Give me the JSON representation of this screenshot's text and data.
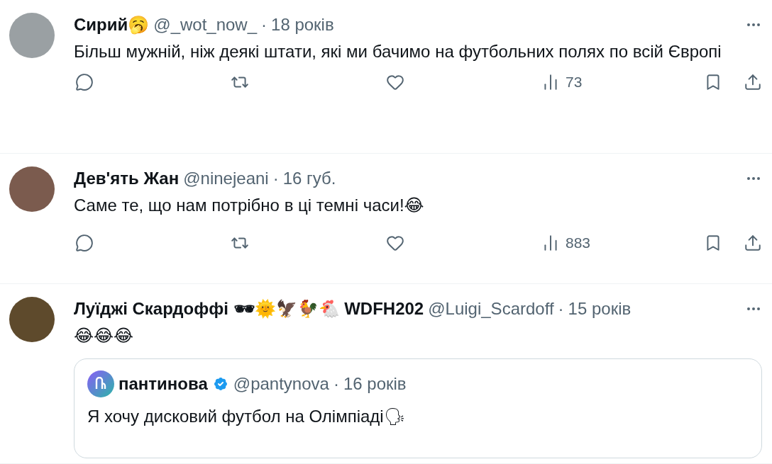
{
  "tweets": [
    {
      "name": "Сирий🥱",
      "handle": "@_wot_now_",
      "dot": "·",
      "time": "18 років",
      "text": "Більш мужній, ніж деякі штати, які ми бачимо на футбольних полях по всій Європі",
      "views": "73"
    },
    {
      "name": "Дев'ять Жан",
      "handle": "@ninejeani",
      "dot": "·",
      "time": "16 губ.",
      "text": "Саме те, що нам потрібно в ці темні часи!😂",
      "views": "883"
    },
    {
      "name": "Луїджі Скардоффі 🕶🌞🦅🐓🐔 WDFH202",
      "handle": "@Luigi_Scardoff",
      "dot": "·",
      "time": "15 років",
      "text": "😂😂😂",
      "quote": {
        "name": "пантинова",
        "verified": true,
        "handle": "@pantynova",
        "dot": "·",
        "time": "16 років",
        "text": "Я хочу дисковий футбол на Олімпіаді🗣"
      }
    }
  ]
}
